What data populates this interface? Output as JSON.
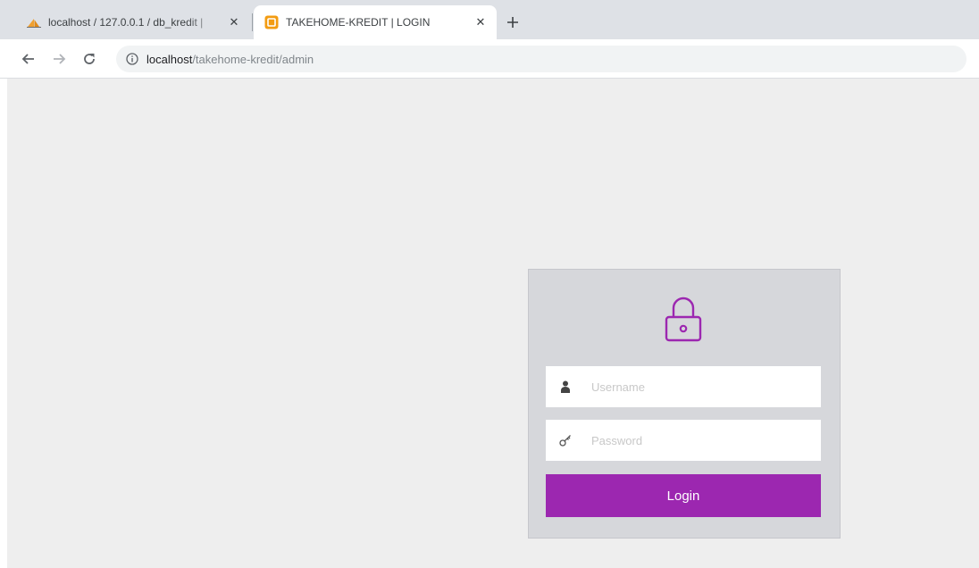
{
  "browser": {
    "tabs": [
      {
        "title": "localhost / 127.0.0.1 / db_kredit |",
        "favicon": "phpmyadmin-sail-icon",
        "active": false,
        "close_glyph": "✕"
      },
      {
        "title": "TAKEHOME-KREDIT | LOGIN",
        "favicon": "orange-square-icon",
        "active": true,
        "close_glyph": "✕"
      }
    ],
    "new_tab_icon": "plus-icon",
    "toolbar": {
      "back_icon": "arrow-left-icon",
      "forward_icon": "arrow-right-icon",
      "reload_icon": "reload-icon",
      "security_icon": "info-circle-icon",
      "url_host": "localhost",
      "url_path": "/takehome-kredit/admin"
    }
  },
  "login": {
    "lock_icon": "padlock-icon",
    "username_icon": "user-icon",
    "username_placeholder": "Username",
    "username_value": "",
    "password_icon": "key-icon",
    "password_placeholder": "Password",
    "password_value": "",
    "button_label": "Login"
  },
  "colors": {
    "accent": "#9c27b0",
    "page_background": "#eeeeee",
    "panel_background": "#d6d7db",
    "tabstrip_background": "#dee1e6",
    "favicon_orange": "#f39c12"
  }
}
